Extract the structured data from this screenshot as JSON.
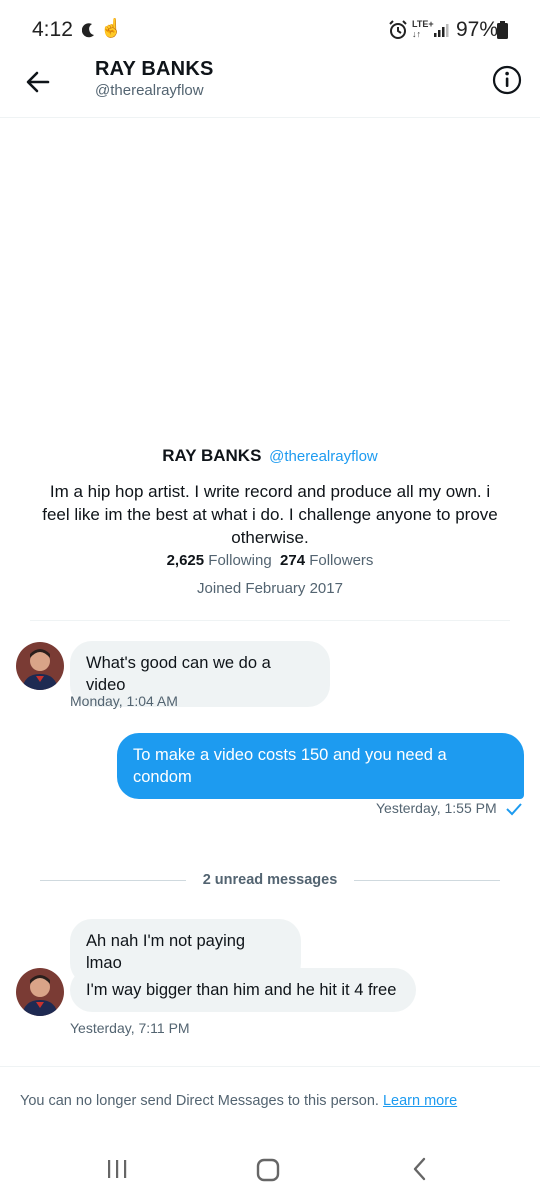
{
  "status_bar": {
    "time": "4:12",
    "network": "LTE+",
    "battery": "97%"
  },
  "header": {
    "name": "RAY BANKS",
    "handle": "@therealrayflow"
  },
  "profile": {
    "name": "RAY BANKS",
    "handle": "@therealrayflow",
    "bio": "Im a hip hop artist. I write record and produce all my own. i feel like im the best at what i do. I challenge anyone to prove otherwise.",
    "following_count": "2,625",
    "following_label": "Following",
    "followers_count": "274",
    "followers_label": "Followers",
    "joined": "Joined February 2017"
  },
  "messages": [
    {
      "direction": "incoming",
      "text": "What's good can we do a video",
      "timestamp": "Monday, 1:04 AM"
    },
    {
      "direction": "outgoing",
      "text": "To make a video costs 150 and you need a condom",
      "timestamp": "Yesterday, 1:55 PM"
    },
    {
      "direction": "incoming",
      "text": "Ah nah I'm not paying lmao"
    },
    {
      "direction": "incoming",
      "text": "I'm way bigger than him and he hit it 4 free",
      "timestamp": "Yesterday, 7:11 PM"
    }
  ],
  "unread_divider": "2 unread messages",
  "footer": {
    "notice": "You can no longer send Direct Messages to this person.",
    "link": "Learn more"
  },
  "colors": {
    "accent": "#1d9bf0",
    "incoming_bubble": "#eff3f4",
    "secondary_text": "#536471"
  }
}
